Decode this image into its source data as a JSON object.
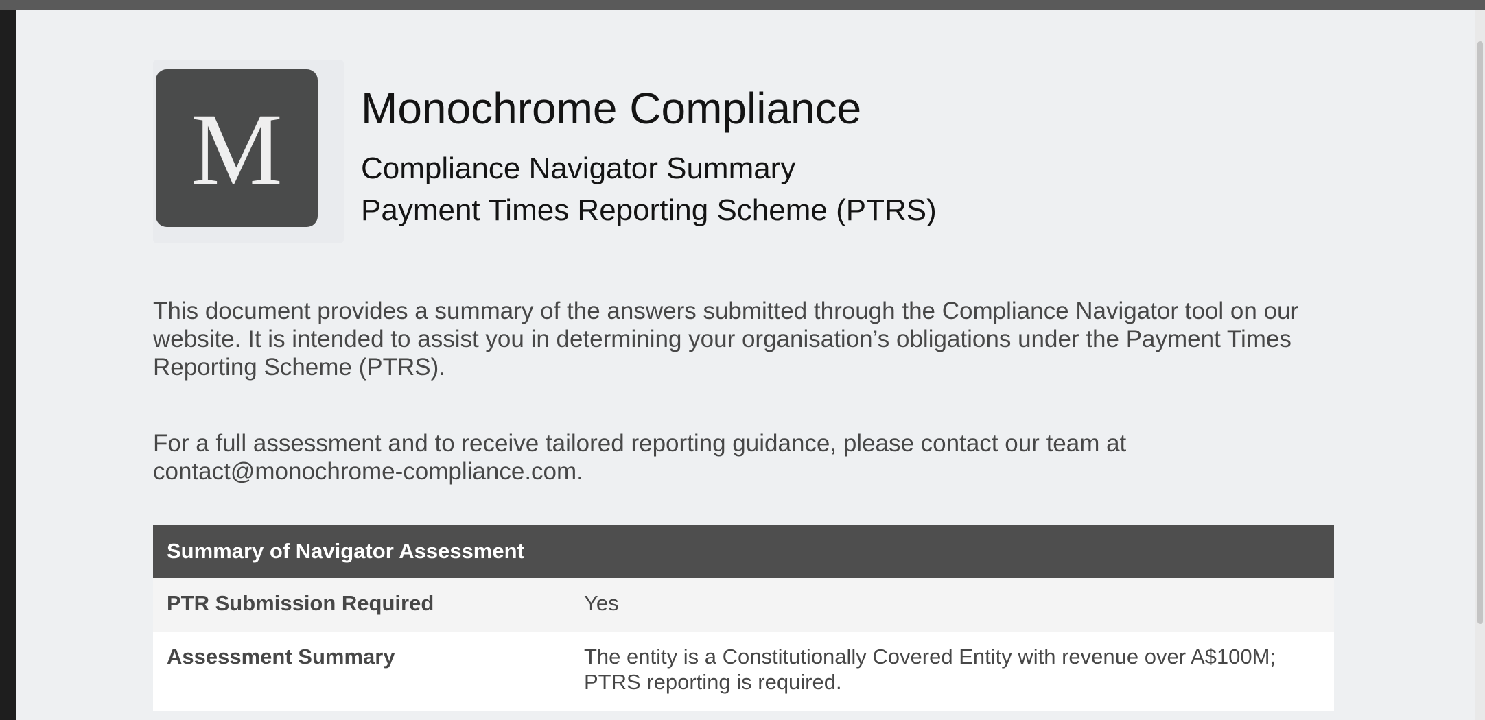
{
  "header": {
    "logo_letter": "M",
    "title": "Monochrome Compliance",
    "subtitle_1": "Compliance Navigator Summary",
    "subtitle_2": "Payment Times Reporting Scheme (PTRS)"
  },
  "intro": {
    "paragraph_1": "This document provides a summary of the answers submitted through the Compliance Navigator tool on our website. It is intended to assist you in determining your organisation’s obligations under the Payment Times Reporting Scheme (PTRS).",
    "paragraph_2": "For a full assessment and to receive tailored reporting guidance, please contact our team at contact@monochrome-compliance.com."
  },
  "summary_table": {
    "heading": "Summary of Navigator Assessment",
    "rows": [
      {
        "label": "PTR Submission Required",
        "value": "Yes"
      },
      {
        "label": "Assessment Summary",
        "value": "The entity is a Constitutionally Covered Entity with revenue over A$100M; PTRS reporting is required."
      }
    ]
  },
  "colors": {
    "page_background": "#eef0f2",
    "logo_background": "#4a4b4b",
    "table_header": "#4e4e4e"
  }
}
